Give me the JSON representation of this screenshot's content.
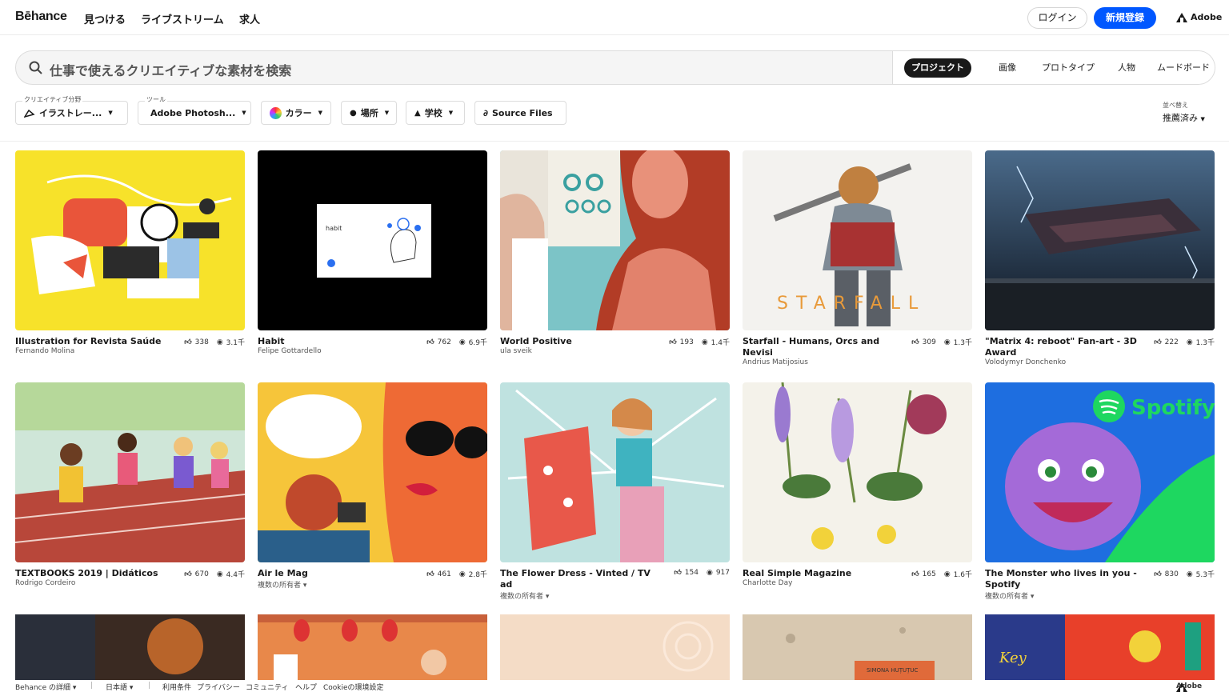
{
  "nav": {
    "logo": "Bēhance",
    "links": [
      "見つける",
      "ライブストリーム",
      "求人"
    ],
    "login": "ログイン",
    "signup": "新規登録",
    "adobe": "Adobe"
  },
  "search": {
    "placeholder": "仕事で使えるクリエイティブな素材を検索",
    "tabs": [
      "プロジェクト",
      "画像",
      "プロトタイプ",
      "人物",
      "ムードボード"
    ]
  },
  "filters": {
    "field_label": "クリエイティブ分野",
    "field_value": "イラストレー...",
    "tool_label": "ツール",
    "tool_value": "Adobe Photosh...",
    "color": "カラー",
    "location": "場所",
    "school": "学校",
    "source": "Source Files",
    "sort_label": "並べ替え",
    "sort_value": "推薦済み"
  },
  "projects": [
    {
      "title": "Illustration for Revista Saúde",
      "owner": "Fernando Molina",
      "likes": "338",
      "views": "3.1千"
    },
    {
      "title": "Habit",
      "owner": "Felipe Gottardello",
      "likes": "762",
      "views": "6.9千"
    },
    {
      "title": "World Positive",
      "owner": "ula sveik",
      "likes": "193",
      "views": "1.4千"
    },
    {
      "title": "Starfall - Humans, Orcs and Nevisi",
      "owner": "Andrius Matijosius",
      "likes": "309",
      "views": "1.3千"
    },
    {
      "title": "\"Matrix 4: reboot\" Fan-art - 3D Award",
      "owner": "Volodymyr Donchenko",
      "likes": "222",
      "views": "1.3千"
    },
    {
      "title": "TEXTBOOKS 2019 | Didáticos",
      "owner": "Rodrigo Cordeiro",
      "likes": "670",
      "views": "4.4千"
    },
    {
      "title": "Air le Mag",
      "owner": "複数の所有者 ▾",
      "likes": "461",
      "views": "2.8千"
    },
    {
      "title": "The Flower Dress - Vinted / TV ad",
      "owner": "複数の所有者 ▾",
      "likes": "154",
      "views": "917"
    },
    {
      "title": "Real Simple Magazine",
      "owner": "Charlotte Day",
      "likes": "165",
      "views": "1.6千"
    },
    {
      "title": "The Monster who lives in you - Spotify",
      "owner": "複数の所有者 ▾",
      "likes": "830",
      "views": "5.3千"
    }
  ],
  "thumb_text": {
    "habit": "habit",
    "starfall": "STARFALL",
    "spotify": "Spotify",
    "simona": "SIMONA HUȚUȚUC",
    "key": "Key"
  },
  "footer": {
    "more": "Behance の詳細 ▾",
    "lang": "日本語 ▾",
    "terms": "利用条件",
    "privacy": "プライバシー",
    "community": "コミュニティ",
    "help": "ヘルプ",
    "cookie": "Cookieの環境設定",
    "adobe": "Adobe"
  },
  "colors": {
    "brand_blue": "#0057ff",
    "dark": "#191919"
  }
}
